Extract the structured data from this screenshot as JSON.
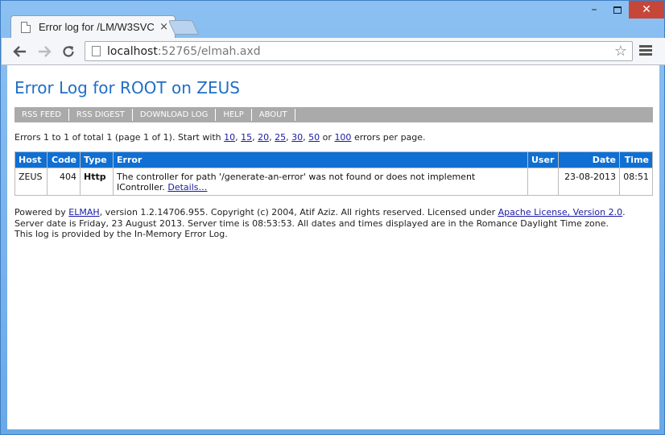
{
  "browser": {
    "tab_title": "Error log for /LM/W3SVC/",
    "tab_close": "×",
    "url_host": "localhost",
    "url_rest": ":52765/elmah.axd",
    "window_minimize": "–",
    "window_close": "✕"
  },
  "page": {
    "title": "Error Log for ROOT on ZEUS",
    "menu": [
      "RSS FEED",
      "RSS DIGEST",
      "DOWNLOAD LOG",
      "HELP",
      "ABOUT"
    ],
    "pager": {
      "prefix": "Errors 1 to 1 of total 1 (page 1 of 1). Start with",
      "sizes": [
        "10",
        "15",
        "20",
        "25",
        "30",
        "50"
      ],
      "or": "or",
      "last": "100",
      "suffix": "errors per page."
    },
    "table": {
      "headers": [
        "Host",
        "Code",
        "Type",
        "Error",
        "User",
        "Date",
        "Time"
      ],
      "rows": [
        {
          "host": "ZEUS",
          "code": "404",
          "type": "Http",
          "error": "The controller for path '/generate-an-error' was not found or does not implement IController.",
          "details": "Details…",
          "user": "",
          "date": "23-08-2013",
          "time": "08:51"
        }
      ]
    },
    "footer": {
      "powered_prefix": "Powered by",
      "elmah": "ELMAH",
      "powered_mid": ", version 1.2.14706.955. Copyright (c) 2004, Atif Aziz. All rights reserved. Licensed under",
      "license": "Apache License, Version 2.0",
      "powered_end": ".",
      "server_line": "Server date is Friday, 23 August 2013. Server time is 08:53:53. All dates and times displayed are in the Romance Daylight Time zone.",
      "log_line": "This log is provided by the In-Memory Error Log."
    }
  },
  "colors": {
    "title": "#1f6fc6",
    "header_bg": "#0f6fd3",
    "menubar_bg": "#aaaaaa",
    "link": "#1a1aa6"
  }
}
